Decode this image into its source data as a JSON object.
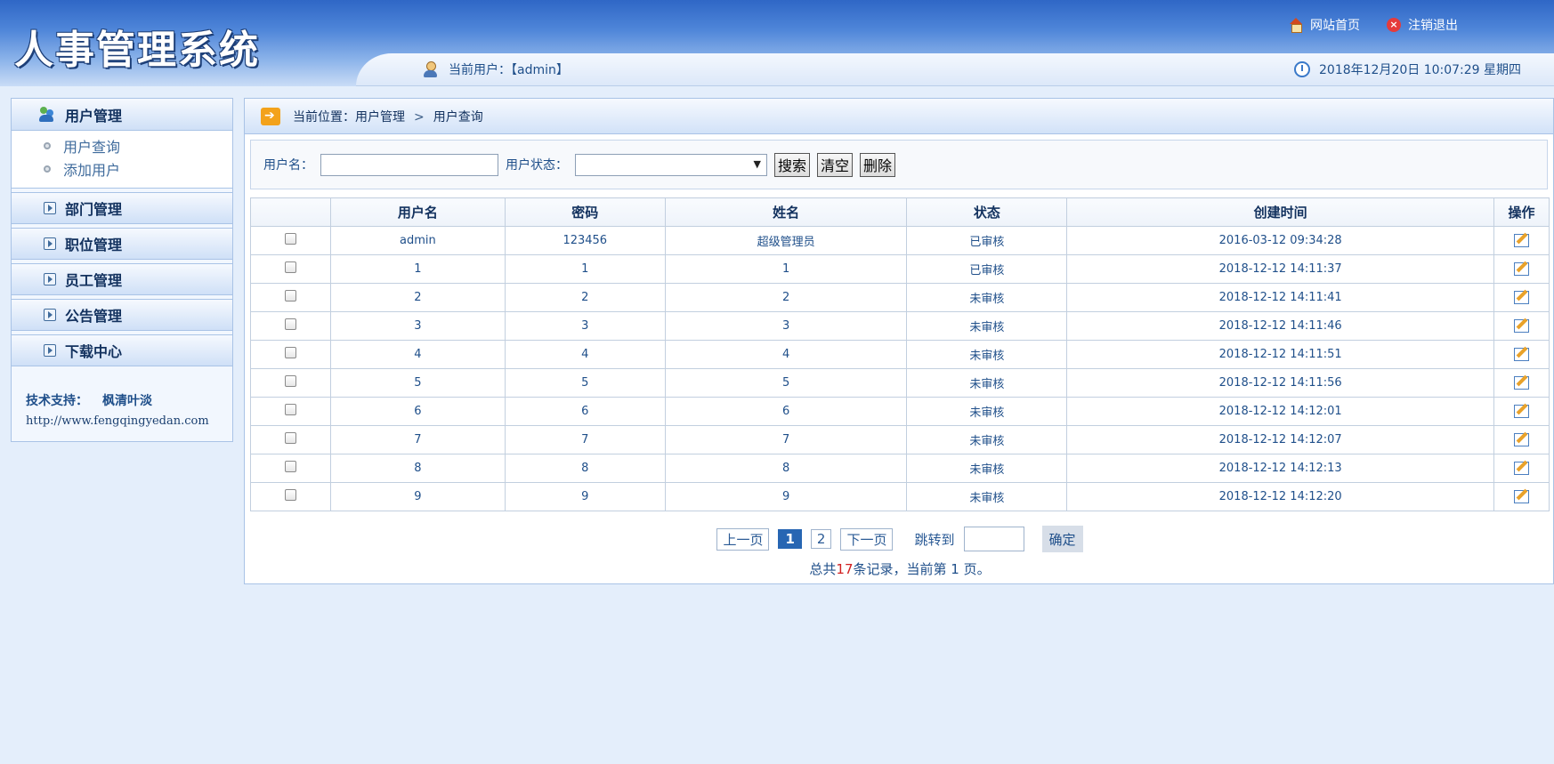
{
  "header": {
    "logo_text": "人事管理系统",
    "home_link": "网站首页",
    "logout_link": "注销退出",
    "current_user": "当前用户：【admin】",
    "datetime": "2018年12月20日 10:07:29 星期四"
  },
  "sidebar": {
    "active_section": "用户管理",
    "sub_items": [
      "用户查询",
      "添加用户"
    ],
    "sections": [
      "部门管理",
      "职位管理",
      "员工管理",
      "公告管理",
      "下载中心"
    ],
    "tech_label": "技术支持：",
    "tech_name": "枫清叶淡",
    "tech_url": "http://www.fengqingyedan.com"
  },
  "breadcrumb": {
    "prefix": "当前位置：",
    "level1": "用户管理",
    "separator": ">",
    "level2": "用户查询"
  },
  "search": {
    "username_label": "用户名：",
    "username_value": "",
    "status_label": "用户状态：",
    "status_value": "",
    "search_btn": "搜索",
    "clear_btn": "清空",
    "delete_btn": "删除"
  },
  "table": {
    "headers": [
      "",
      "用户名",
      "密码",
      "姓名",
      "状态",
      "创建时间",
      "操作"
    ],
    "rows": [
      [
        "admin",
        "123456",
        "超级管理员",
        "已审核",
        "2016-03-12 09:34:28"
      ],
      [
        "1",
        "1",
        "1",
        "已审核",
        "2018-12-12 14:11:37"
      ],
      [
        "2",
        "2",
        "2",
        "未审核",
        "2018-12-12 14:11:41"
      ],
      [
        "3",
        "3",
        "3",
        "未审核",
        "2018-12-12 14:11:46"
      ],
      [
        "4",
        "4",
        "4",
        "未审核",
        "2018-12-12 14:11:51"
      ],
      [
        "5",
        "5",
        "5",
        "未审核",
        "2018-12-12 14:11:56"
      ],
      [
        "6",
        "6",
        "6",
        "未审核",
        "2018-12-12 14:12:01"
      ],
      [
        "7",
        "7",
        "7",
        "未审核",
        "2018-12-12 14:12:07"
      ],
      [
        "8",
        "8",
        "8",
        "未审核",
        "2018-12-12 14:12:13"
      ],
      [
        "9",
        "9",
        "9",
        "未审核",
        "2018-12-12 14:12:20"
      ]
    ]
  },
  "pager": {
    "prev": "上一页",
    "pages": [
      "1",
      "2"
    ],
    "current_page": "1",
    "next": "下一页",
    "jump_label": "跳转到",
    "confirm": "确定",
    "total_prefix": "总共",
    "total_count": "17",
    "total_suffix": "条记录，当前第 1 页。"
  },
  "colors": {
    "header_blue": "#2f67c6",
    "page_bg": "#e4eefb",
    "accent_red": "#d12020",
    "active_page": "#2766b3"
  }
}
